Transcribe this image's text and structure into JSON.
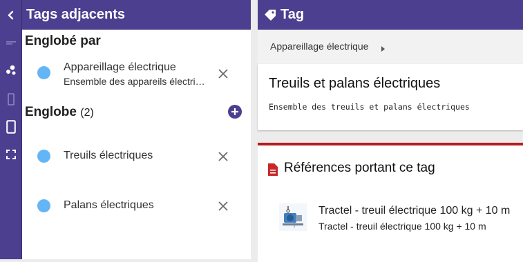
{
  "rail": {
    "icons": [
      "chevron-left-icon",
      "minus-icon",
      "bubbles-icon",
      "phone-outline-icon",
      "tablet-icon",
      "fullscreen-icon"
    ]
  },
  "adjacent_panel": {
    "title": "Tags adjacents",
    "included_by": {
      "title": "Englobé par",
      "items": [
        {
          "name": "Appareillage électrique",
          "description": "Ensemble des appareils électriques"
        }
      ]
    },
    "includes": {
      "title": "Englobe",
      "count": "(2)",
      "items": [
        {
          "name": "Treuils électriques"
        },
        {
          "name": "Palans électriques"
        }
      ]
    }
  },
  "tag_panel": {
    "header_title": "Tag",
    "breadcrumb": "Appareillage électrique",
    "name": "Treuils et palans électriques",
    "description": "Ensemble des treuils et palans électriques"
  },
  "references": {
    "title": "Références portant ce tag",
    "items": [
      {
        "name": "Tractel - treuil électrique 100 kg + 10 m",
        "description": "Tractel - treuil électrique 100 kg + 10 m"
      }
    ]
  },
  "colors": {
    "primary": "#4c3f8f",
    "dot": "#64b5f6",
    "accent_red": "#b71c1c",
    "add_button": "#4c3f8f"
  }
}
